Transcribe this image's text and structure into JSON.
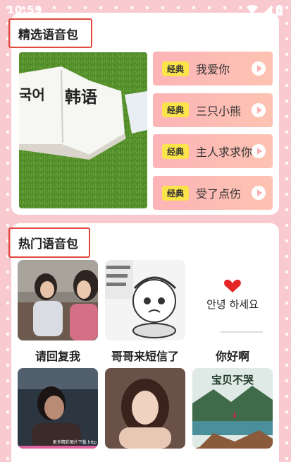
{
  "status_bar": {
    "time": "10:59",
    "icons": [
      "wifi-icon",
      "signal-icon",
      "battery-icon"
    ]
  },
  "featured": {
    "title": "精选语音包",
    "image_caption": "韩语",
    "image_snippet": "국어",
    "items": [
      {
        "tag": "经典",
        "title": "我爱你"
      },
      {
        "tag": "经典",
        "title": "三只小熊"
      },
      {
        "tag": "经典",
        "title": "主人求求你"
      },
      {
        "tag": "经典",
        "title": "受了点伤"
      }
    ]
  },
  "hot": {
    "title": "热门语音包",
    "items": [
      {
        "label": "请回复我"
      },
      {
        "label": "哥哥来短信了"
      },
      {
        "label": "你好啊",
        "thumb_text": "안녕 하세요"
      },
      {
        "label": "",
        "thumb_text": "更多精彩图片下载 http"
      },
      {
        "label": ""
      },
      {
        "label": "",
        "thumb_text": "宝贝不哭"
      }
    ]
  },
  "colors": {
    "background": "#f9c9d0",
    "accent_border": "#e2483d",
    "tag": "#fbe34a",
    "item_bg": "#fdb4b7"
  }
}
